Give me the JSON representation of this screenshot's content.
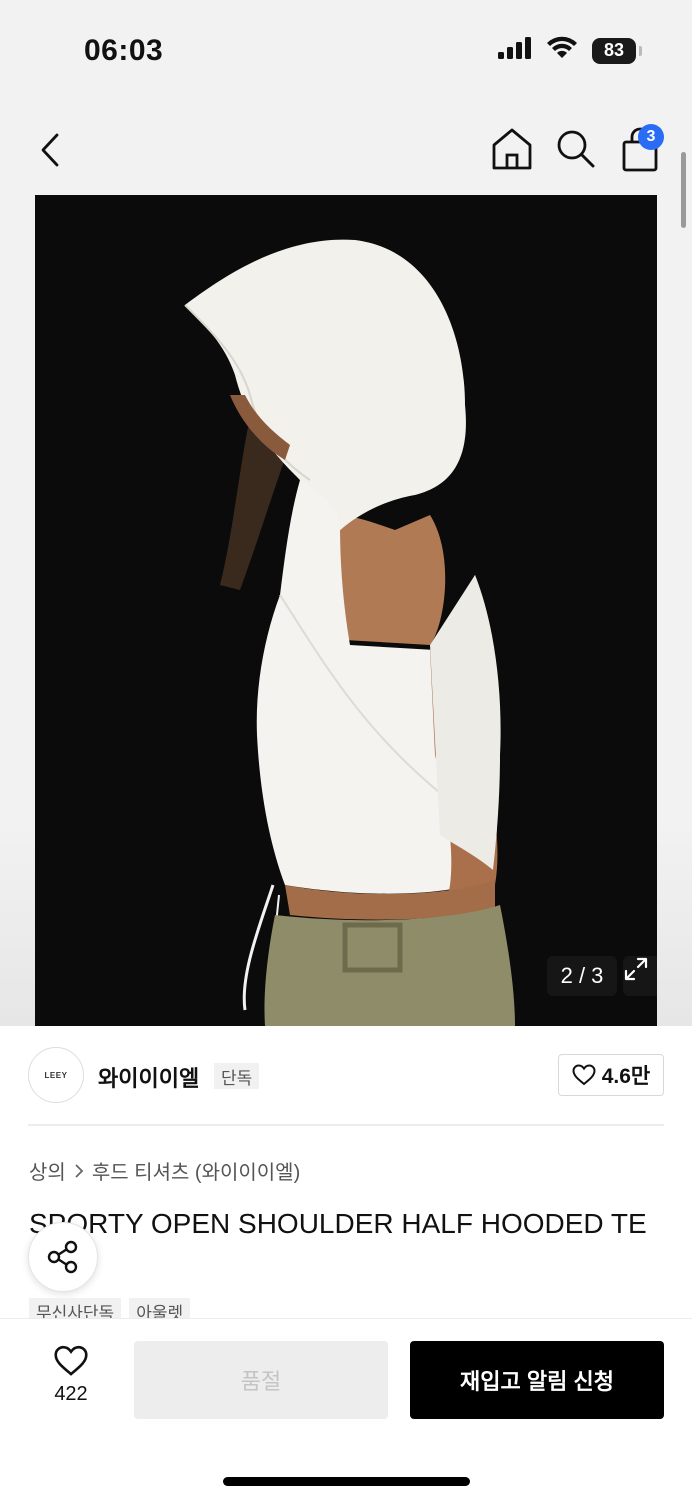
{
  "status_bar": {
    "time": "06:03",
    "battery": "83",
    "icons": [
      "cellular-signal-icon",
      "wifi-icon",
      "battery-icon"
    ]
  },
  "nav": {
    "icons": [
      "back-arrow-icon",
      "home-icon",
      "search-icon",
      "shopping-bag-icon"
    ],
    "cart_count": "3"
  },
  "gallery": {
    "counter": "2 / 3",
    "icons": [
      "expand-icon"
    ]
  },
  "brand": {
    "logo_text": "LEEY",
    "name": "와이이이엘",
    "exclusive_tag": "단독",
    "like_count": "4.6만",
    "icons": [
      "heart-outline-icon"
    ]
  },
  "breadcrumb": {
    "category": "상의",
    "subcategory": "후드 티셔츠 (와이이이엘)",
    "icons": [
      "chevron-right-icon"
    ]
  },
  "product": {
    "title": "SPORTY OPEN SHOULDER HALF HOODED TE",
    "tags": [
      "무신사단독",
      "아울렛"
    ]
  },
  "share": {
    "icons": [
      "share-icon"
    ]
  },
  "bottom_bar": {
    "like_count": "422",
    "soldout_label": "품절",
    "restock_label": "재입고 알림 신청",
    "icons": [
      "heart-outline-icon"
    ]
  },
  "colors": {
    "accent_badge": "#2a6df4",
    "primary_button": "#000000",
    "disabled_button": "#ededed"
  }
}
